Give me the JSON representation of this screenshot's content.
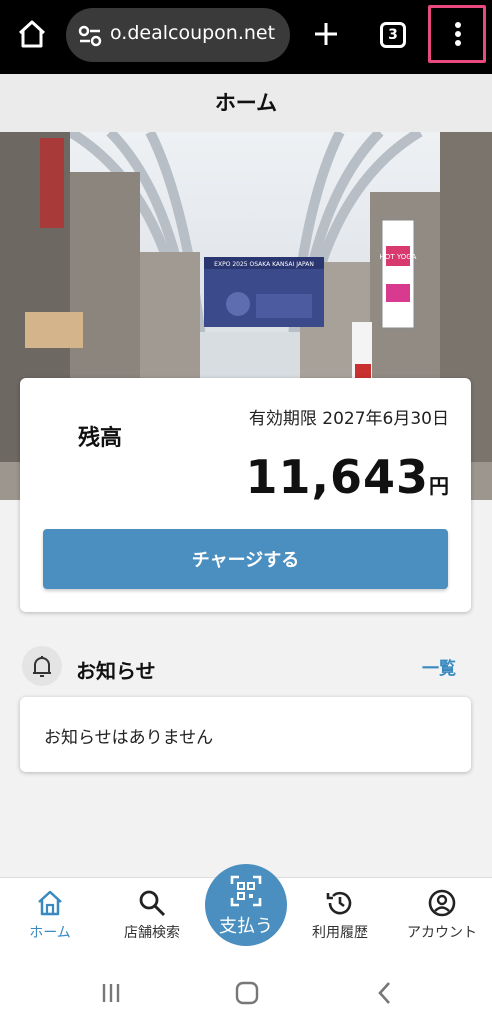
{
  "browser": {
    "url": "o.dealcoupon.net",
    "tab_count": "3",
    "icons": [
      "home-icon",
      "site-settings-icon",
      "plus-icon",
      "tabs-icon",
      "more-vert-icon"
    ]
  },
  "page": {
    "title": "ホーム"
  },
  "hero": {
    "sign_banner": "EXPO 2025 OSAKA KANSAI JAPAN",
    "sign_hot_yoga": "HOT YOGA"
  },
  "balance": {
    "label": "残高",
    "expiry": "有効期限 2027年6月30日",
    "amount": "11,643",
    "currency": "円",
    "charge_button": "チャージする"
  },
  "news": {
    "title": "お知らせ",
    "link": "一覧",
    "empty_message": "お知らせはありません"
  },
  "nav": {
    "home": "ホーム",
    "store_search": "店舗検索",
    "pay": "支払う",
    "history": "利用履歴",
    "account": "アカウント"
  },
  "colors": {
    "accent": "#4a8fc0",
    "accent_text": "#3a8ac0",
    "highlight_border": "#e84a7f"
  }
}
